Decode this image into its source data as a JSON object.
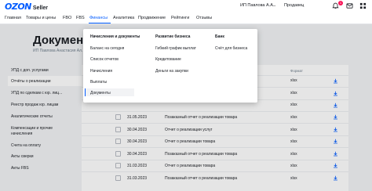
{
  "header": {
    "logo_brand": "OZON",
    "logo_sub": "Seller",
    "user_name": "ИП Павлова А.А.",
    "role": "Продавец",
    "notifications_count": "1",
    "icons": [
      "bell-icon",
      "mail-icon",
      "grid-icon"
    ]
  },
  "nav": {
    "items": [
      "Главная",
      "Товары и цены",
      "FBO",
      "FBS",
      "Финансы",
      "Аналитика",
      "Продвижение",
      "Рейтинги",
      "Отзывы"
    ],
    "active": "Финансы"
  },
  "page": {
    "title": "Документы",
    "subtitle": "ИП Павлова Анастасия Ал..."
  },
  "sidebar": {
    "items": [
      "УПД с доп. услугами",
      "Отчёты о реализации",
      "УПД по сделкам с юр. лиц...",
      "Реестр продаж юр. лицам",
      "Аналитические отчеты",
      "Компенсации и прочие",
      "начисления",
      "Счета на оплату",
      "Акты сверки",
      "Акты FBS"
    ],
    "active": "Отчёты о реализации"
  },
  "table": {
    "format_header": "Формат",
    "rows": [
      {
        "date": "",
        "name": "",
        "format": "xlsx"
      },
      {
        "date": "",
        "name": "",
        "format": "xlsx"
      },
      {
        "date": "",
        "name": "",
        "format": "xlsx"
      },
      {
        "date": "31.05.2023",
        "name": "Позаказный отчет о реализации товара",
        "format": "xlsx"
      },
      {
        "date": "30.04.2023",
        "name": "Отчет о реализации услуг",
        "format": "xlsx"
      },
      {
        "date": "30.04.2023",
        "name": "Отчет о реализации товара",
        "format": "xlsx"
      },
      {
        "date": "30.04.2023",
        "name": "Позаказный отчет о реализации товара",
        "format": "xlsx"
      },
      {
        "date": "31.03.2023",
        "name": "Отчет о реализации товара",
        "format": "xlsx"
      },
      {
        "date": "31.03.2023",
        "name": "Позаказный отчет о реализации товара",
        "format": "xlsx"
      }
    ]
  },
  "dropdown": {
    "col1": {
      "heading": "Начисления и документы",
      "items": [
        "Баланс на сегодня",
        "Список отчетов",
        "Начисления",
        "Выплаты",
        "Документы"
      ],
      "active": "Документы"
    },
    "col2": {
      "heading": "Развитие бизнеса",
      "items": [
        "Гибкий график выплат",
        "Кредитование",
        "Деньги на закупки"
      ]
    },
    "col3": {
      "heading": "Банк",
      "items": [
        "Счёт для бизнеса"
      ]
    }
  },
  "colors": {
    "accent": "#005bff",
    "badge": "#f91155"
  }
}
